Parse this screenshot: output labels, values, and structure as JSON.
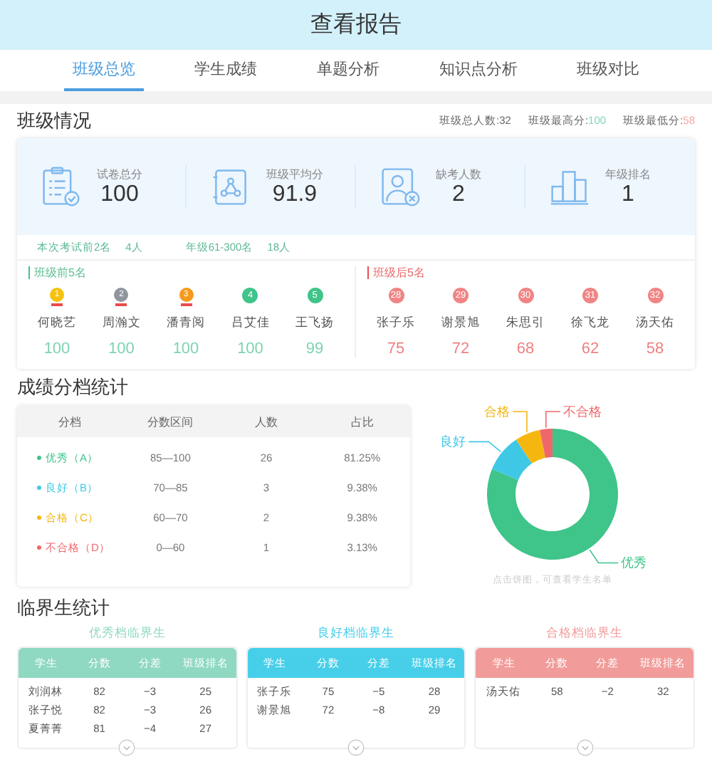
{
  "header": {
    "title": "查看报告"
  },
  "tabs": [
    {
      "label": "班级总览",
      "selected": true
    },
    {
      "label": "学生成绩",
      "selected": false
    },
    {
      "label": "单题分析",
      "selected": false
    },
    {
      "label": "知识点分析",
      "selected": false
    },
    {
      "label": "班级对比",
      "selected": false
    }
  ],
  "class_overview": {
    "title": "班级情况",
    "summary": [
      {
        "label": "班级总人数:",
        "value": "32",
        "kind": "plain"
      },
      {
        "label": "班级最高分:",
        "value": "100",
        "kind": "high"
      },
      {
        "label": "班级最低分:",
        "value": "58",
        "kind": "low"
      }
    ],
    "stats": [
      {
        "kind": "clipboard",
        "label": "试卷总分",
        "value": "100"
      },
      {
        "kind": "book",
        "label": "班级平均分",
        "value": "91.9"
      },
      {
        "kind": "absent",
        "label": "缺考人数",
        "value": "2"
      },
      {
        "kind": "rank",
        "label": "年级排名",
        "value": "1"
      }
    ],
    "notes": [
      {
        "label": "本次考试前2名",
        "value": "4人"
      },
      {
        "label": "年级61-300名",
        "value": "18人"
      }
    ],
    "top5": {
      "title": "班级前5名",
      "students": [
        {
          "rank": "1",
          "kind": "gold",
          "name": "何晓艺",
          "score": "100"
        },
        {
          "rank": "2",
          "kind": "silver",
          "name": "周瀚文",
          "score": "100"
        },
        {
          "rank": "3",
          "kind": "bronze",
          "name": "潘青阅",
          "score": "100"
        },
        {
          "rank": "4",
          "kind": "circle",
          "name": "吕艾佳",
          "score": "100"
        },
        {
          "rank": "5",
          "kind": "circle",
          "name": "王飞扬",
          "score": "99"
        }
      ]
    },
    "bottom5": {
      "title": "班级后5名",
      "students": [
        {
          "rank": "28",
          "kind": "circle",
          "name": "张子乐",
          "score": "75"
        },
        {
          "rank": "29",
          "kind": "circle",
          "name": "谢景旭",
          "score": "72"
        },
        {
          "rank": "30",
          "kind": "circle",
          "name": "朱思引",
          "score": "68"
        },
        {
          "rank": "31",
          "kind": "circle",
          "name": "徐飞龙",
          "score": "62"
        },
        {
          "rank": "32",
          "kind": "circle",
          "name": "汤天佑",
          "score": "58"
        }
      ]
    }
  },
  "grade_stats": {
    "title": "成绩分档统计",
    "columns": [
      "分档",
      "分数区间",
      "人数",
      "占比"
    ],
    "rows": [
      {
        "grade": "优秀（A）",
        "color": "#3fc48a",
        "range": "85—100",
        "count": "26",
        "share": "81.25%"
      },
      {
        "grade": "良好（B）",
        "color": "#3fc8e6",
        "range": "70—85",
        "count": "3",
        "share": "9.38%"
      },
      {
        "grade": "合格（C）",
        "color": "#f5b70f",
        "range": "60—70",
        "count": "2",
        "share": "9.38%"
      },
      {
        "grade": "不合格（D）",
        "color": "#f0676b",
        "range": "0—60",
        "count": "1",
        "share": "3.13%"
      }
    ],
    "donut_labels": [
      "优秀",
      "良好",
      "合格",
      "不合格"
    ],
    "hint": "点击饼图，可查看学生名单"
  },
  "borderline": {
    "title": "临界生统计",
    "groups": [
      {
        "title": "优秀档临界生",
        "color": "#8fd8c1",
        "columns": [
          "学生",
          "分数",
          "分差",
          "班级排名"
        ],
        "rows": [
          [
            "刘润林",
            "82",
            "−3",
            "25"
          ],
          [
            "张子悦",
            "82",
            "−3",
            "26"
          ],
          [
            "夏菁菁",
            "81",
            "−4",
            "27"
          ]
        ]
      },
      {
        "title": "良好档临界生",
        "color": "#47cfe9",
        "columns": [
          "学生",
          "分数",
          "分差",
          "班级排名"
        ],
        "rows": [
          [
            "张子乐",
            "75",
            "−5",
            "28"
          ],
          [
            "谢景旭",
            "72",
            "−8",
            "29"
          ]
        ]
      },
      {
        "title": "合格档临界生",
        "color": "#f19c9a",
        "columns": [
          "学生",
          "分数",
          "分差",
          "班级排名"
        ],
        "rows": [
          [
            "汤天佑",
            "58",
            "−2",
            "32"
          ]
        ]
      }
    ]
  }
}
